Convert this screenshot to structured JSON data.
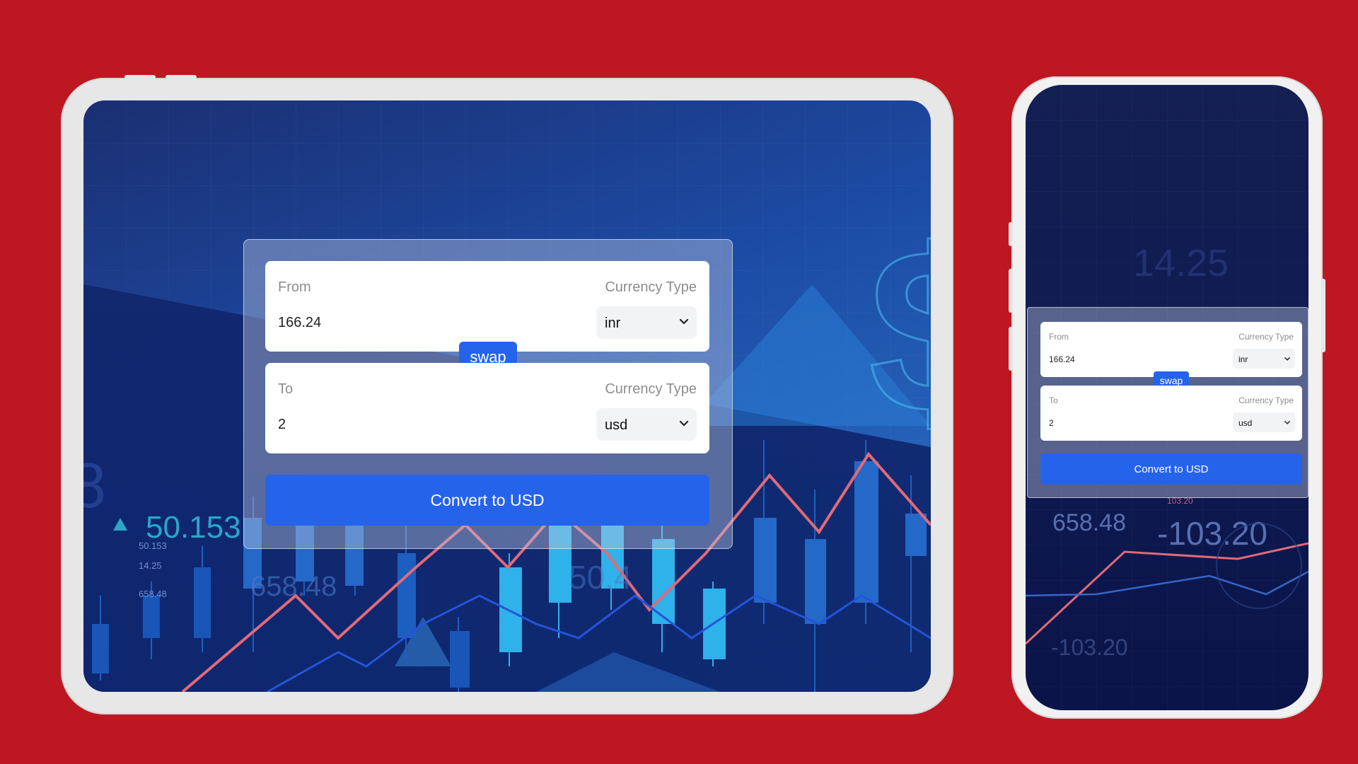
{
  "colors": {
    "page_background": "#bd1822",
    "device_frame": "#e7e7e7",
    "accent": "#2563eb",
    "card_glass": "rgba(190,200,225,0.42)",
    "candle_up": "#2fb1ea",
    "candle_dark": "#1a55b8",
    "line_red": "#e06a78"
  },
  "background_text": {
    "ticker_value": "50.153",
    "ticker_small": [
      "50.153",
      "14.25",
      "658.48"
    ],
    "overlay_a": "658.48",
    "overlay_b": "50.4",
    "phone_a": "14.25",
    "phone_b": "658.48",
    "phone_c": "-103.20",
    "phone_d": "-103.20",
    "phone_e": "103.20",
    "dollar_sign": "$",
    "partial_digit": "8"
  },
  "converter": {
    "from": {
      "label": "From",
      "currency_label": "Currency Type",
      "amount": "166.24",
      "currency": "inr"
    },
    "swap_label": "swap",
    "to": {
      "label": "To",
      "currency_label": "Currency Type",
      "amount": "2",
      "currency": "usd"
    },
    "convert_label": "Convert to USD"
  },
  "icons": {
    "select_chevron": "chevron-down-icon",
    "ticker_arrow": "triangle-up-icon"
  }
}
